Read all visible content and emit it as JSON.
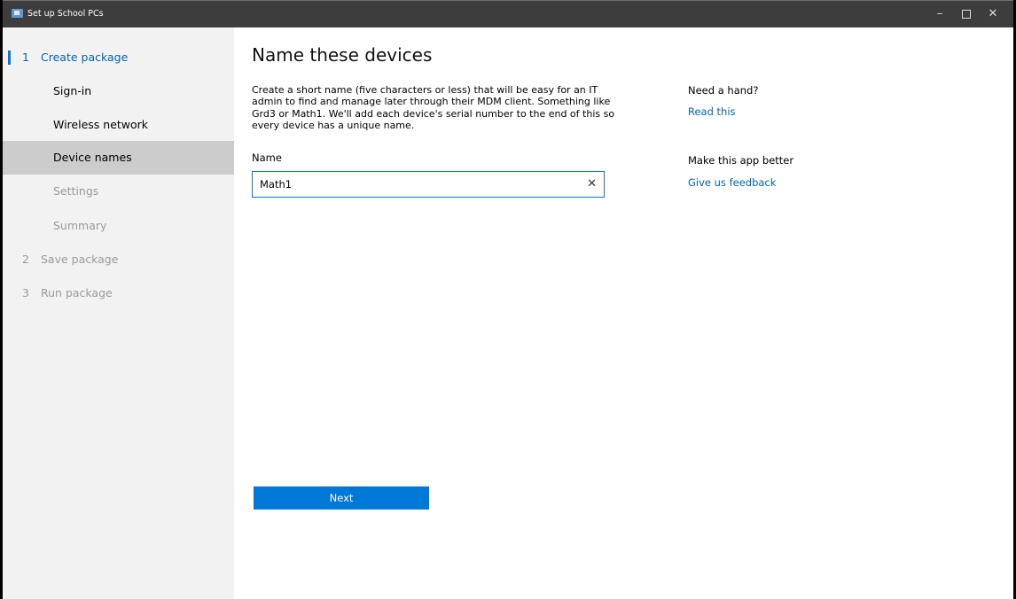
{
  "window": {
    "title": "Set up School PCs",
    "minimize": "–",
    "close": "✕"
  },
  "sidebar": {
    "items": [
      {
        "num": "1",
        "label": "Create package"
      },
      {
        "label": "Sign-in"
      },
      {
        "label": "Wireless network"
      },
      {
        "label": "Device names"
      },
      {
        "label": "Settings"
      },
      {
        "label": "Summary"
      },
      {
        "num": "2",
        "label": "Save package"
      },
      {
        "num": "3",
        "label": "Run package"
      }
    ]
  },
  "main": {
    "title": "Name these devices",
    "description": "Create a short name (five characters or less) that will be easy for an IT admin to find and manage later through their MDM client. Something like Grd3 or Math1. We'll add each device's serial number to the end of this so every device has a unique name.",
    "name_label": "Name",
    "name_value": "Math1",
    "clear_glyph": "✕",
    "next_label": "Next"
  },
  "help": {
    "need_hand": "Need a hand?",
    "read_this": "Read this",
    "make_better": "Make this app better",
    "feedback": "Give us feedback"
  },
  "colors": {
    "accent": "#0078d7",
    "link": "#0063b1",
    "titlebar": "#3d3d3d",
    "sidebar": "#f2f2f2",
    "selected": "#cccccc"
  }
}
